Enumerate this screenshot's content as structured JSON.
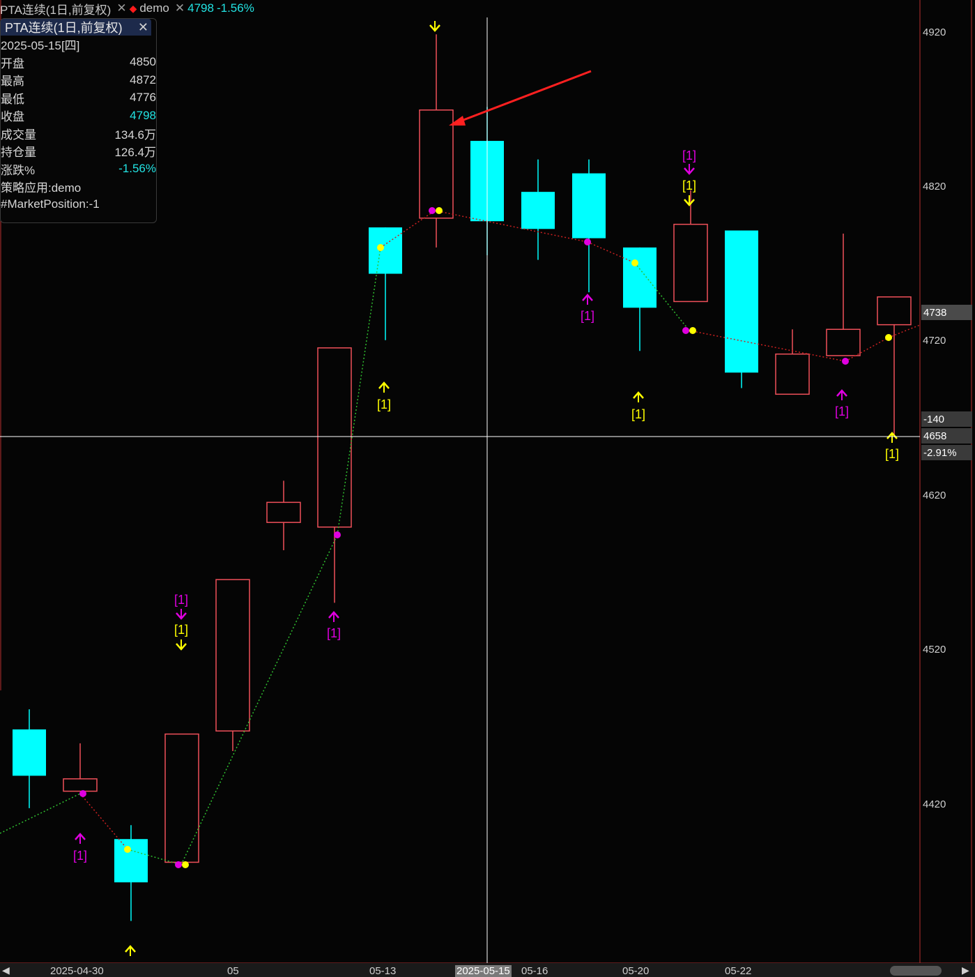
{
  "title_bar": {
    "symbol": "PTA连续(1日,前复权)",
    "strategy": "demo",
    "last_price": "4798",
    "change_pct": "-1.56%"
  },
  "info_panel": {
    "header": "PTA连续(1日,前复权)",
    "date": "2025-05-15[四]",
    "rows": [
      {
        "label": "开盘",
        "value": "4850"
      },
      {
        "label": "最高",
        "value": "4872"
      },
      {
        "label": "最低",
        "value": "4776"
      },
      {
        "label": "收盘",
        "value": "4798"
      },
      {
        "label": "成交量",
        "value": "134.6万"
      },
      {
        "label": "持仓量",
        "value": "126.4万"
      },
      {
        "label": "涨跌%",
        "value": "-1.56%"
      }
    ],
    "strategy_line": "策略应用:demo",
    "position_line": "#MarketPosition:-1"
  },
  "price_axis": {
    "labels": [
      "4920",
      "4820",
      "4720",
      "4620",
      "4520",
      "4420"
    ],
    "current_tag": "4738",
    "cursor_tags": [
      "-140",
      "4658",
      "-2.91%"
    ]
  },
  "date_axis": {
    "labels": [
      "2025-04-30",
      "05",
      "05-13",
      "05-16",
      "05-20",
      "05-22"
    ],
    "cursor_date": "2025-05-15"
  },
  "colors": {
    "up": "#f0505a",
    "down": "#00ffff",
    "signal_yellow": "#ffff00",
    "signal_magenta": "#e000e0",
    "arrow_red": "#ff2020"
  },
  "chart_data": {
    "type": "candlestick",
    "ylim": [
      4345,
      4933
    ],
    "candles": [
      {
        "o": 4469,
        "h": 4482,
        "l": 4418,
        "c": 4439,
        "dir": "down"
      },
      {
        "o": 4429,
        "h": 4460,
        "l": null,
        "c": 4437,
        "dir": "up"
      },
      {
        "o": 4398,
        "h": 4407,
        "l": 4345,
        "c": 4370,
        "dir": "down"
      },
      {
        "o": 4383,
        "h": 4434,
        "l": 4383,
        "c": 4466,
        "dir": "up"
      },
      {
        "o": 4468,
        "h": 4560,
        "l": 4455,
        "c": 4566,
        "dir": "up"
      },
      {
        "o": 4603,
        "h": 4630,
        "l": 4585,
        "c": 4616,
        "dir": "up"
      },
      {
        "o": 4600,
        "h": 4716,
        "l": 4551,
        "c": 4716,
        "dir": "up"
      },
      {
        "o": 4794,
        "h": 4794,
        "l": 4721,
        "c": 4764,
        "dir": "down"
      },
      {
        "o": 4800,
        "h": 4919,
        "l": 4781,
        "c": 4870,
        "dir": "up"
      },
      {
        "o": 4850,
        "h": 4872,
        "l": 4776,
        "c": 4798,
        "dir": "down"
      },
      {
        "o": 4817,
        "h": 4838,
        "l": 4773,
        "c": 4793,
        "dir": "down"
      },
      {
        "o": 4829,
        "h": 4838,
        "l": 4752,
        "c": 4787,
        "dir": "down"
      },
      {
        "o": 4781,
        "h": 4781,
        "l": 4714,
        "c": 4742,
        "dir": "down"
      },
      {
        "o": 4746,
        "h": 4818,
        "l": 4746,
        "c": 4796,
        "dir": "up"
      },
      {
        "o": 4792,
        "h": 4792,
        "l": 4690,
        "c": 4700,
        "dir": "down"
      },
      {
        "o": 4686,
        "h": 4728,
        "l": 4686,
        "c": 4712,
        "dir": "up"
      },
      {
        "o": 4711,
        "h": 4790,
        "l": 4711,
        "c": 4728,
        "dir": "up"
      },
      {
        "o": 4731,
        "h": 4741,
        "l": 4659,
        "c": 4749,
        "dir": "up"
      }
    ],
    "signal_labels": [
      "[1]"
    ]
  }
}
